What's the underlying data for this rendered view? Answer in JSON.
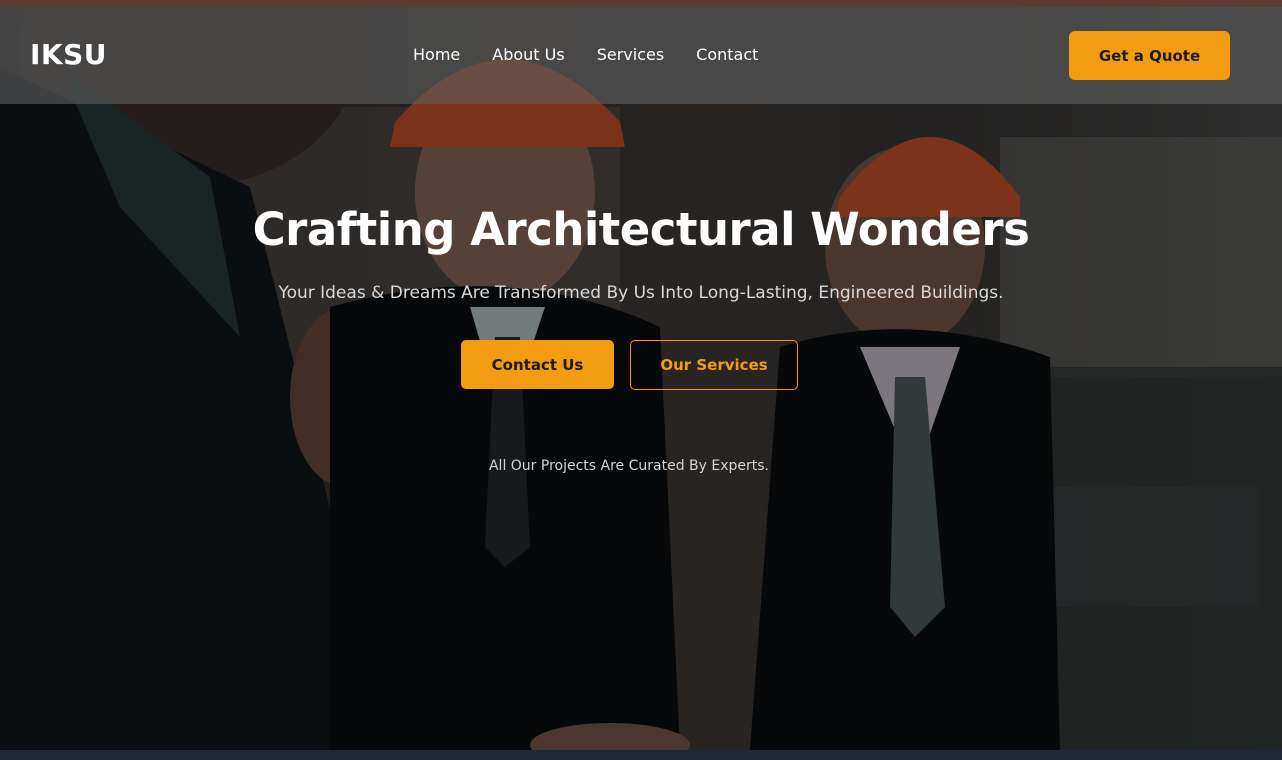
{
  "brand": {
    "logo": "IKSU",
    "accent_color": "#f39c12"
  },
  "nav": {
    "links": [
      "Home",
      "About Us",
      "Services",
      "Contact"
    ],
    "cta_label": "Get a Quote"
  },
  "hero": {
    "background_image": "construction-engineers-in-hard-hats",
    "headline": "Crafting Architectural Wonders",
    "subheadline": "Your Ideas & Dreams Are Transformed By Us Into Long-Lasting, Engineered Buildings.",
    "primary_button": "Contact Us",
    "secondary_button": "Our Services",
    "tagline": "All Our Projects Are Curated By Experts."
  }
}
